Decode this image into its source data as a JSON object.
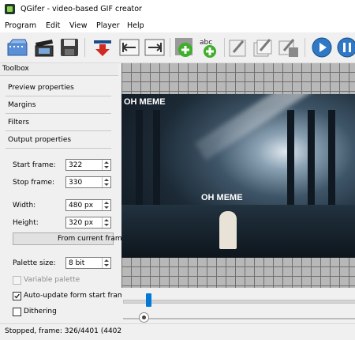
{
  "window": {
    "title": "QGifer - video-based GIF creator"
  },
  "menu": [
    "Program",
    "Edit",
    "View",
    "Player",
    "Help"
  ],
  "toolbar": {
    "icons": [
      "open-video-icon",
      "open-camera-icon",
      "save-icon",
      "extract-icon",
      "set-start-icon",
      "set-end-icon",
      "add-object-icon",
      "add-text-icon",
      "edit-icon",
      "edit-frames-icon",
      "save-frames-icon",
      "play-icon",
      "pause-icon"
    ]
  },
  "toolbox": {
    "title": "Toolbox",
    "sections": [
      "Preview properties",
      "Margins",
      "Filters",
      "Output properties"
    ],
    "start_frame": {
      "label": "Start frame:",
      "value": "322"
    },
    "stop_frame": {
      "label": "Stop frame:",
      "value": "330"
    },
    "width": {
      "label": "Width:",
      "value": "480 px"
    },
    "height": {
      "label": "Height:",
      "value": "320 px"
    },
    "from_current_button": "From current fram",
    "palette_size": {
      "label": "Palette size:",
      "value": "8 bit"
    },
    "variable_palette": {
      "label": "Variable palette",
      "checked": false,
      "enabled": false
    },
    "auto_update": {
      "label": "Auto-update form start fram",
      "checked": true
    },
    "dithering": {
      "label": "Dithering",
      "checked": false
    }
  },
  "preview": {
    "top_text": "OH MEME",
    "center_text": "OH MEME"
  },
  "playback": {
    "range_position": 0.11,
    "seek_position": 0.09
  },
  "status": {
    "text": "Stopped, frame: 326/4401 (4402"
  },
  "colors": {
    "accent": "#0078d7",
    "checker_light": "#b8b8b8",
    "checker_dark": "#6f6f6f"
  }
}
